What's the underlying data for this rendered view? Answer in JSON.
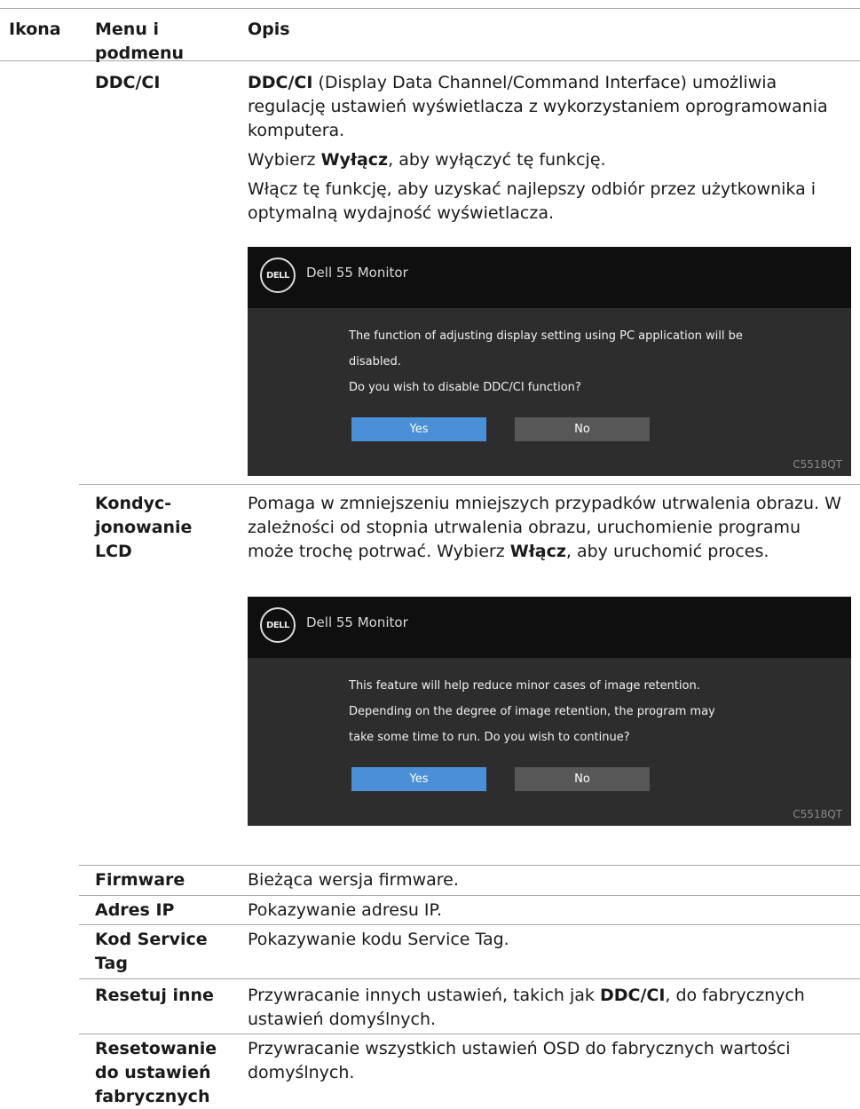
{
  "header": {
    "col_icon": "Ikona",
    "col_menu": "Menu i podmenu",
    "col_desc": "Opis"
  },
  "rows": [
    {
      "menu": "DDC/CI",
      "desc_p1_bold": "DDC/CI",
      "desc_p1_rest": " (Display Data Channel/Command Interface) umożliwia regulację ustawień wyświetlacza z wykorzystaniem oprogramowania komputera.",
      "desc_p2_pre": "Wybierz ",
      "desc_p2_bold": "Wyłącz",
      "desc_p2_post": ", aby wyłączyć tę funkcję.",
      "desc_p3": "Włącz tę funkcję, aby uzyskać najlepszy odbiór przez użytkownika i optymalną wydajność wyświetlacza.",
      "osd": {
        "logo": "DELL",
        "title": "Dell 55 Monitor",
        "message_lines": [
          "The function of adjusting display setting using PC application will be",
          "disabled.",
          "Do you wish to disable DDC/CI function?"
        ],
        "yes": "Yes",
        "no": "No",
        "model": "C5518QT"
      }
    },
    {
      "menu": "Kondyc-jonowanie LCD",
      "desc_text": "Pomaga w zmniejszeniu mniejszych przypadków utrwalenia obrazu. W zależności od stopnia utrwalenia obrazu, uruchomienie programu może trochę potrwać. Wybierz ",
      "desc_bold": "Włącz",
      "desc_post": ", aby uruchomić proces.",
      "osd": {
        "logo": "DELL",
        "title": "Dell 55 Monitor",
        "message_lines": [
          "This feature will help reduce minor cases of image retention.",
          "Depending on the degree of image retention, the program may",
          "take some time to run. Do you wish to continue?"
        ],
        "yes": "Yes",
        "no": "No",
        "model": "C5518QT"
      }
    },
    {
      "menu": "Firmware",
      "desc": "Bieżąca wersja firmware."
    },
    {
      "menu": "Adres IP",
      "desc": "Pokazywanie adresu IP."
    },
    {
      "menu": "Kod Service Tag",
      "desc": "Pokazywanie kodu Service Tag."
    },
    {
      "menu": "Resetuj inne",
      "desc_pre": "Przywracanie innych ustawień, takich jak ",
      "desc_bold": "DDC/CI",
      "desc_post": ", do fabrycznych ustawień domyślnych."
    },
    {
      "menu": "Resetowanie do ustawień fabrycznych",
      "desc": "Przywracanie wszystkich ustawień OSD do fabrycznych wartości domyślnych."
    }
  ]
}
